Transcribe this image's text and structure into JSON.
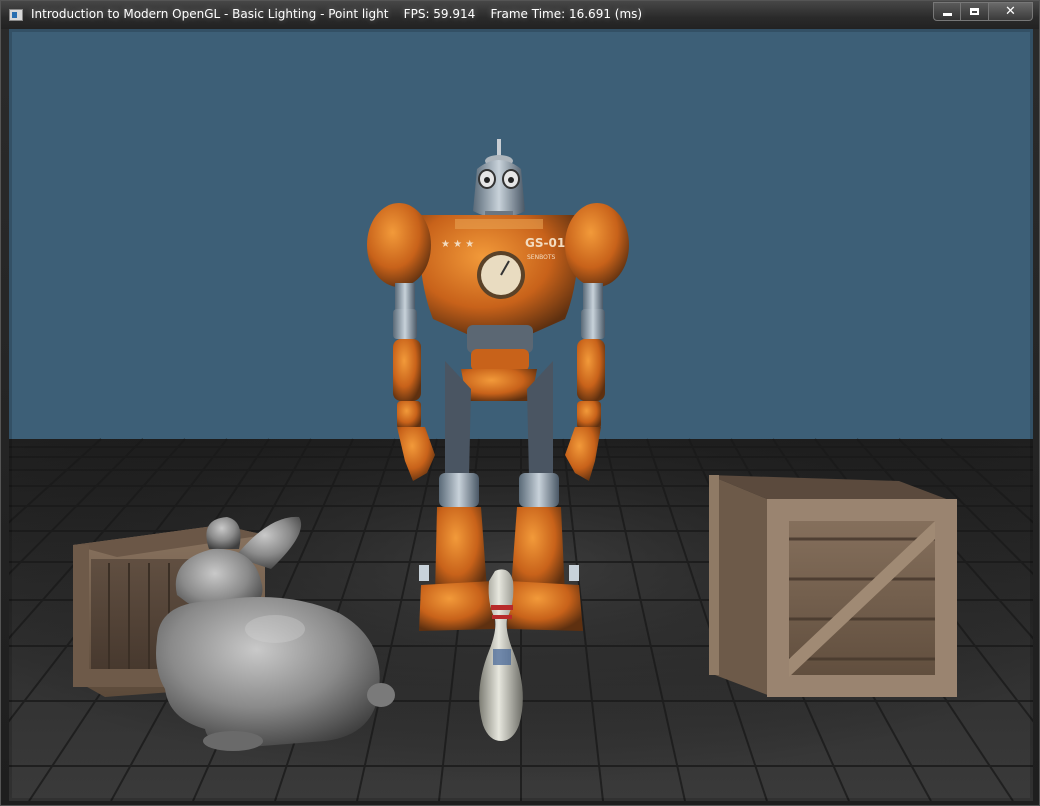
{
  "window": {
    "title": "Introduction to Modern OpenGL - Basic Lighting - Point light    FPS: 59.914    Frame Time: 16.691 (ms)",
    "icon": "app-window-icon",
    "controls": {
      "minimize_icon": "minimize-icon",
      "maximize_icon": "maximize-icon",
      "close_icon": "close-icon",
      "close_glyph": "✕"
    }
  },
  "scene": {
    "sky_color": "#3d5f77",
    "floor_color": "#2a2a2a",
    "crate_color": "#7a6350",
    "robot_color": "#d9751e",
    "bunny_color": "#8c8c8c",
    "bowling_pin_color": "#d8d8cf",
    "robot_chest_text": "GS-01",
    "robot_chest_subtext": "SENBOTS"
  }
}
